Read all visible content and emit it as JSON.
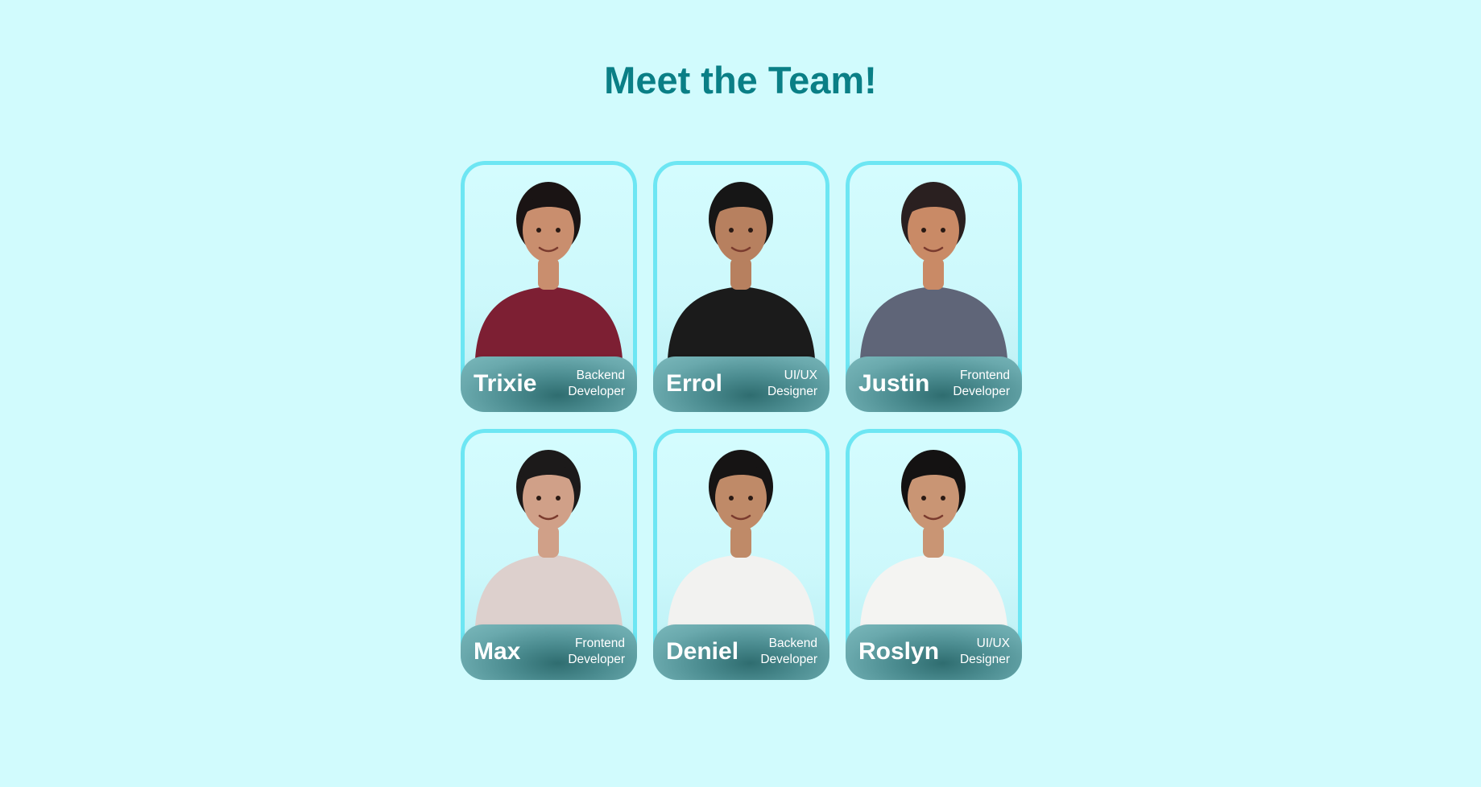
{
  "page": {
    "title": "Meet the Team!"
  },
  "colors": {
    "background": "#d1fbfd",
    "title": "#0a7f86",
    "card_border": "#6de6f3",
    "nameplate": "#4b8c90"
  },
  "team": [
    {
      "name": "Trixie",
      "role": "Backend\nDeveloper",
      "photo_icon": "person-maroon-shirt-icon",
      "shirt": "#7d1f33",
      "skin": "#c98e6e",
      "hair": "#1a1414"
    },
    {
      "name": "Errol",
      "role": "UI/UX\nDesigner",
      "photo_icon": "person-black-shirt-icon",
      "shirt": "#1b1b1b",
      "skin": "#b7805f",
      "hair": "#161616"
    },
    {
      "name": "Justin",
      "role": "Frontend\nDeveloper",
      "photo_icon": "person-gray-shirt-icon",
      "shirt": "#5f6578",
      "skin": "#c98a66",
      "hair": "#2a2020"
    },
    {
      "name": "Max",
      "role": "Frontend\nDeveloper",
      "photo_icon": "person-beige-blazer-icon",
      "shirt": "#ddd0cd",
      "skin": "#d0a088",
      "hair": "#1c1a1a"
    },
    {
      "name": "Deniel",
      "role": "Backend\nDeveloper",
      "photo_icon": "person-white-shirt-icon",
      "shirt": "#f2f2f0",
      "skin": "#bf8a68",
      "hair": "#161414"
    },
    {
      "name": "Roslyn",
      "role": "UI/UX\nDesigner",
      "photo_icon": "person-white-blouse-icon",
      "shirt": "#f4f4f2",
      "skin": "#c99574",
      "hair": "#141212"
    }
  ]
}
